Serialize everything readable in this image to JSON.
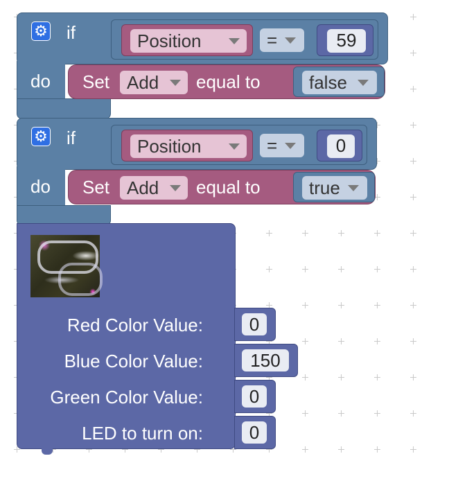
{
  "if_block_1": {
    "if_label": "if",
    "do_label": "do",
    "condition": {
      "variable": "Position",
      "operator": "=",
      "value": "59"
    },
    "action": {
      "set_label": "Set",
      "variable": "Add",
      "equal_label": "equal to",
      "value": "false"
    }
  },
  "if_block_2": {
    "if_label": "if",
    "do_label": "do",
    "condition": {
      "variable": "Position",
      "operator": "=",
      "value": "0"
    },
    "action": {
      "set_label": "Set",
      "variable": "Add",
      "equal_label": "equal to",
      "value": "true"
    }
  },
  "led_block": {
    "inputs": [
      {
        "label": "Red Color Value:",
        "value": "0"
      },
      {
        "label": "Blue Color Value:",
        "value": "150"
      },
      {
        "label": "Green Color Value:",
        "value": "0"
      },
      {
        "label": "LED to turn on:",
        "value": "0"
      }
    ]
  },
  "colors": {
    "logic_block": "#5b80a5",
    "variable_block": "#a55b80",
    "led_block": "#5c68a6",
    "gear_icon": "#2f6fe3"
  },
  "icons": {
    "mutator": "gear-icon",
    "dropdown": "caret-down-icon"
  }
}
